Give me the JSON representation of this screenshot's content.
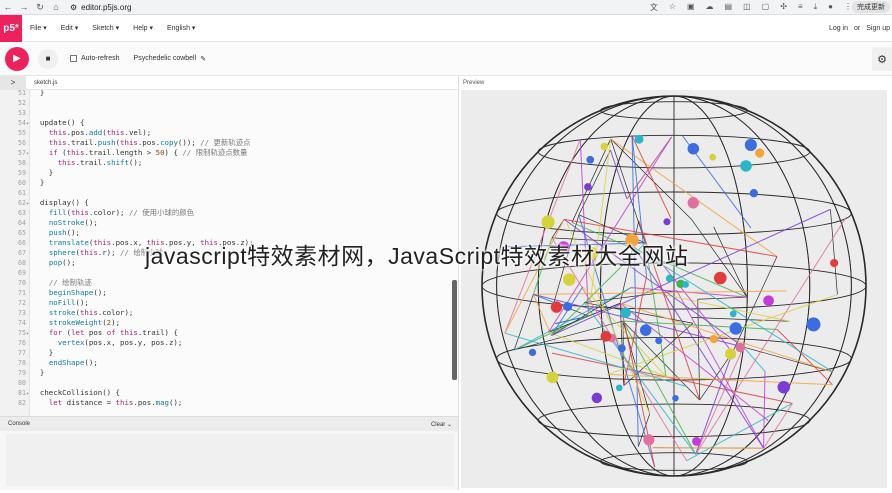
{
  "browser": {
    "url": "editor.p5js.org",
    "update_button": "完成更新"
  },
  "menubar": {
    "logo": "p5*",
    "items": [
      "File ▾",
      "Edit ▾",
      "Sketch ▾",
      "Help ▾",
      "English ▾"
    ],
    "login": "Log in",
    "or": "or",
    "signup": "Sign up"
  },
  "toolbar": {
    "auto_refresh": "Auto-refresh",
    "sketch_name": "Psychedelic cowbell",
    "edit_icon": "pencil-icon"
  },
  "editor": {
    "tab": "sketch.js",
    "lines": [
      {
        "n": "51",
        "t": "  }"
      },
      {
        "n": "52",
        "t": ""
      },
      {
        "n": "53",
        "t": ""
      },
      {
        "n": "54",
        "t": "  update() {",
        "fold": true
      },
      {
        "n": "55",
        "t": "    this.pos.add(this.vel);"
      },
      {
        "n": "56",
        "t": "    this.trail.push(this.pos.copy()); // 更新轨迹点"
      },
      {
        "n": "57",
        "t": "    if (this.trail.length > 50) { // 限制轨迹点数量",
        "fold": true
      },
      {
        "n": "58",
        "t": "      this.trail.shift();"
      },
      {
        "n": "59",
        "t": "    }"
      },
      {
        "n": "60",
        "t": "  }"
      },
      {
        "n": "61",
        "t": ""
      },
      {
        "n": "62",
        "t": "  display() {",
        "fold": true
      },
      {
        "n": "63",
        "t": "    fill(this.color); // 使用小球的颜色"
      },
      {
        "n": "64",
        "t": "    noStroke();"
      },
      {
        "n": "65",
        "t": "    push();"
      },
      {
        "n": "66",
        "t": "    translate(this.pos.x, this.pos.y, this.pos.z);"
      },
      {
        "n": "67",
        "t": "    sphere(this.r); // 绘制小球"
      },
      {
        "n": "68",
        "t": "    pop();"
      },
      {
        "n": "69",
        "t": ""
      },
      {
        "n": "70",
        "t": "    // 绘制轨迹"
      },
      {
        "n": "71",
        "t": "    beginShape();"
      },
      {
        "n": "72",
        "t": "    noFill();"
      },
      {
        "n": "73",
        "t": "    stroke(this.color);"
      },
      {
        "n": "74",
        "t": "    strokeWeight(2);"
      },
      {
        "n": "75",
        "t": "    for (let pos of this.trail) {",
        "fold": true
      },
      {
        "n": "76",
        "t": "      vertex(pos.x, pos.y, pos.z);"
      },
      {
        "n": "77",
        "t": "    }"
      },
      {
        "n": "78",
        "t": "    endShape();"
      },
      {
        "n": "79",
        "t": "  }"
      },
      {
        "n": "80",
        "t": ""
      },
      {
        "n": "81",
        "t": "  checkCollision() {",
        "fold": true
      },
      {
        "n": "82",
        "t": "    let distance = this.pos.mag();"
      }
    ]
  },
  "console": {
    "label": "Console",
    "clear": "Clear"
  },
  "preview": {
    "label": "Preview"
  },
  "overlay": {
    "watermark": "javascript特效素材网，JavaScript特效素材大全网站"
  },
  "colors": {
    "accent": "#ed225d",
    "sphere_lines": "#2a2a2a",
    "canvas_bg": "#ececec"
  }
}
